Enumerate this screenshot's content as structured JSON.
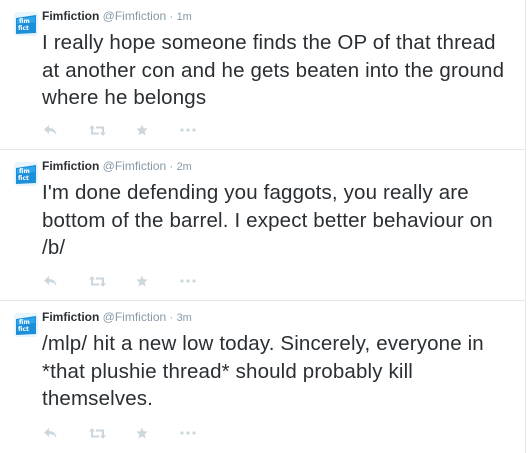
{
  "tweets": [
    {
      "name": "Fimfiction",
      "handle": "@Fimfiction",
      "separator": "·",
      "time": "1m",
      "text": "I really hope someone finds the OP of that thread at another con and he gets beaten into the ground where he belongs"
    },
    {
      "name": "Fimfiction",
      "handle": "@Fimfiction",
      "separator": "·",
      "time": "2m",
      "text": "I'm done defending you faggots, you really are bottom of the barrel. I expect better behaviour on /b/"
    },
    {
      "name": "Fimfiction",
      "handle": "@Fimfiction",
      "separator": "·",
      "time": "3m",
      "text": "/mlp/ hit a new low today. Sincerely, everyone in *that plushie thread* should probably kill themselves."
    }
  ],
  "icons": {
    "avatar": "fimfiction-logo-icon",
    "reply": "reply-icon",
    "retweet": "retweet-icon",
    "favorite": "star-icon",
    "more": "more-dots-icon"
  },
  "colors": {
    "text": "#292f33",
    "meta": "#8899a6",
    "action_icons": "#ccd6dd",
    "divider": "#e1e8ed",
    "avatar_blue": "#1d8fd9"
  }
}
